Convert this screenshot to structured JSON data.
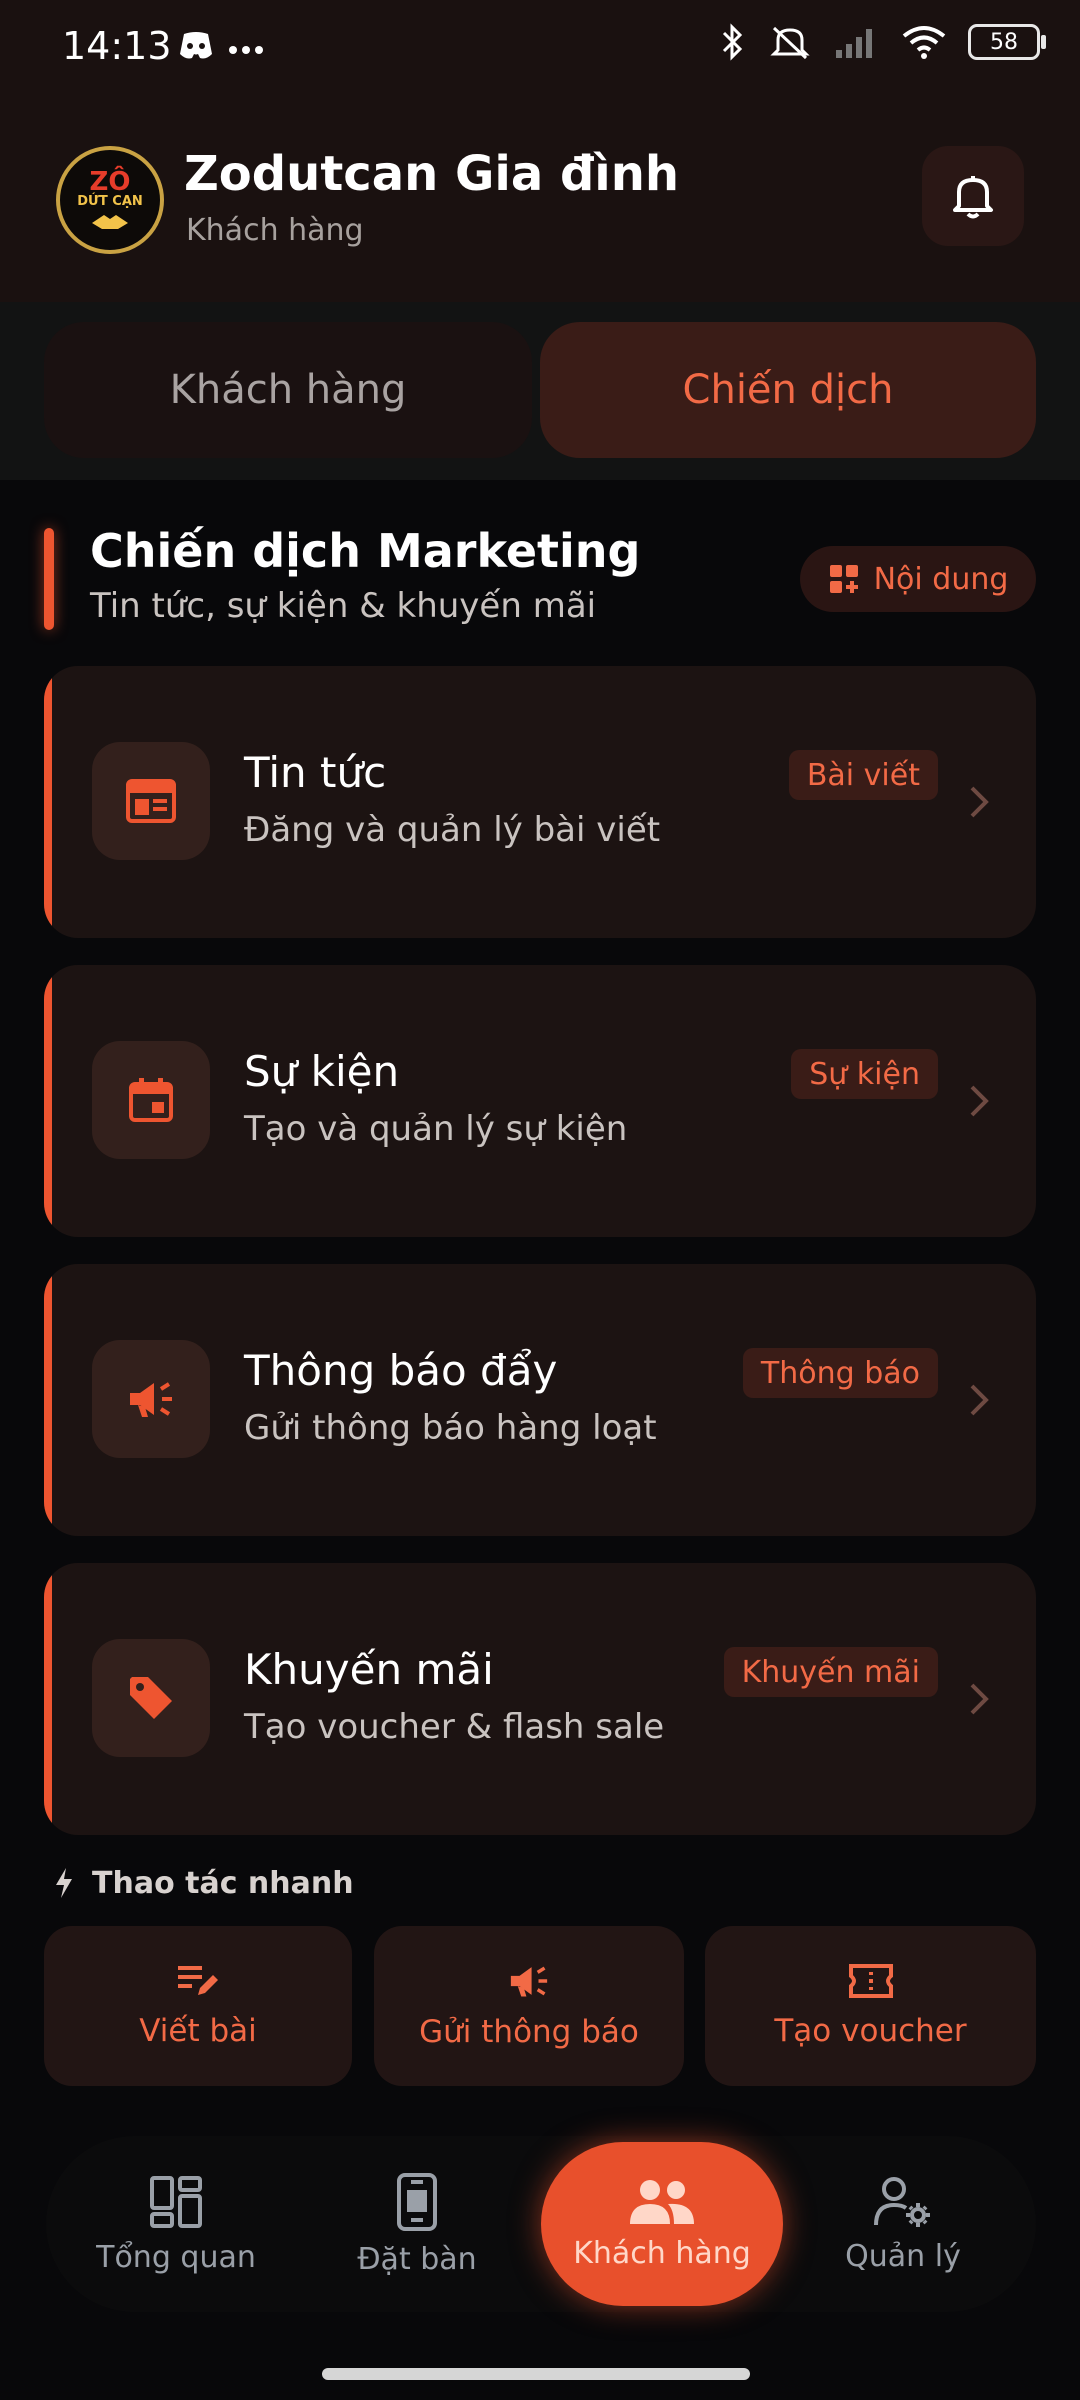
{
  "status_bar": {
    "time": "14:13",
    "battery": "58"
  },
  "header": {
    "logo_line1": "ZÔ",
    "logo_line2": "DỨT CẠN",
    "title": "Zodutcan Gia đình",
    "subtitle": "Khách hàng"
  },
  "tabs": [
    {
      "label": "Khách hàng"
    },
    {
      "label": "Chiến dịch"
    }
  ],
  "section": {
    "title": "Chiến dịch Marketing",
    "subtitle": "Tin tức, sự kiện & khuyến mãi",
    "content_button": "Nội dung"
  },
  "cards": [
    {
      "title": "Tin tức",
      "desc": "Đăng và quản lý bài viết",
      "badge": "Bài viết",
      "icon": "newspaper-icon"
    },
    {
      "title": "Sự kiện",
      "desc": "Tạo và quản lý sự kiện",
      "badge": "Sự kiện",
      "icon": "calendar-icon"
    },
    {
      "title": "Thông báo đẩy",
      "desc": "Gửi thông báo hàng loạt",
      "badge": "Thông báo",
      "icon": "megaphone-icon"
    },
    {
      "title": "Khuyến mãi",
      "desc": "Tạo voucher & flash sale",
      "badge": "Khuyến mãi",
      "icon": "tag-icon"
    }
  ],
  "quick_actions": {
    "label": "Thao tác nhanh",
    "items": [
      {
        "label": "Viết bài",
        "icon": "edit-note-icon"
      },
      {
        "label": "Gửi thông báo",
        "icon": "megaphone-icon"
      },
      {
        "label": "Tạo voucher",
        "icon": "ticket-icon"
      }
    ]
  },
  "bottom_nav": [
    {
      "label": "Tổng quan",
      "icon": "dashboard-icon"
    },
    {
      "label": "Đặt bàn",
      "icon": "table-booking-icon"
    },
    {
      "label": "Khách hàng",
      "icon": "people-icon",
      "active": true
    },
    {
      "label": "Quản lý",
      "icon": "user-settings-icon"
    }
  ],
  "colors": {
    "accent": "#ee5530",
    "card_bg": "#1c1312",
    "background": "#08080a"
  }
}
